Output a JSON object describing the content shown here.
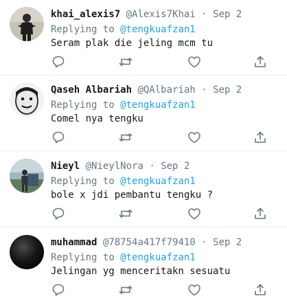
{
  "tweets": [
    {
      "name": "khai_alexis7",
      "handle": "@Alexis7Khai",
      "separator": "·",
      "date": "Sep 2",
      "replying_prefix": "Replying to ",
      "replying_to": "@tengkuafzan1",
      "text": "Seram plak die jeling mcm tu"
    },
    {
      "name": "Qaseh Albariah",
      "handle": "@QAlbariah",
      "separator": "·",
      "date": "Sep 2",
      "replying_prefix": "Replying to ",
      "replying_to": "@tengkuafzan1",
      "text": "Comel nya tengku"
    },
    {
      "name": "Nieyl",
      "handle": "@NieylNora",
      "separator": "·",
      "date": "Sep 2",
      "replying_prefix": "Replying to ",
      "replying_to": "@tengkuafzan1",
      "text": "bole x jdi pembantu tengku ?"
    },
    {
      "name": "muhammad",
      "handle": "@78754a417f79410",
      "separator": "·",
      "date": "Sep 2",
      "replying_prefix": "Replying to ",
      "replying_to": "@tengkuafzan1",
      "text": "Jelingan yg menceritakn sesuatu"
    }
  ],
  "icons": {
    "reply": "reply-icon",
    "retweet": "retweet-icon",
    "like": "like-icon",
    "share": "share-icon"
  },
  "colors": {
    "mention": "#1da1f2",
    "secondary_text": "#657786",
    "primary_text": "#14171a",
    "divider": "#e6ecf0"
  }
}
